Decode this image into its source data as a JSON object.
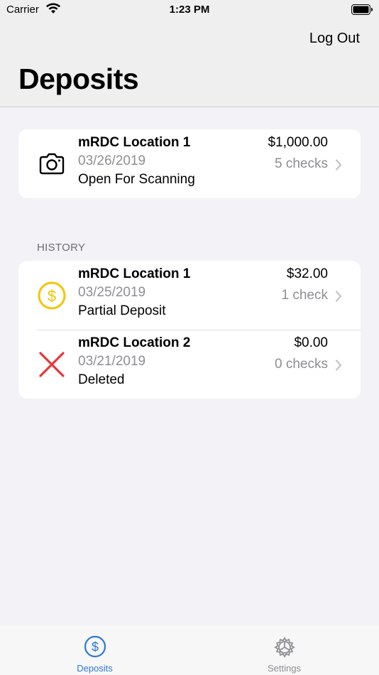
{
  "status_bar": {
    "carrier": "Carrier",
    "time": "1:23 PM"
  },
  "header": {
    "logout_label": "Log Out",
    "title": "Deposits"
  },
  "current_deposit": {
    "name": "mRDC Location 1",
    "date": "03/26/2019",
    "status": "Open For Scanning",
    "amount": "$1,000.00",
    "checks": "5 checks",
    "icon": "camera-icon"
  },
  "history": {
    "section_label": "HISTORY",
    "items": [
      {
        "name": "mRDC Location 1",
        "date": "03/25/2019",
        "status": "Partial Deposit",
        "amount": "$32.00",
        "checks": "1 check",
        "icon": "dollar-circle-icon",
        "icon_color": "#f5c400"
      },
      {
        "name": "mRDC Location 2",
        "date": "03/21/2019",
        "status": "Deleted",
        "amount": "$0.00",
        "checks": "0 checks",
        "icon": "x-mark-icon",
        "icon_color": "#e8363a"
      }
    ]
  },
  "tab_bar": {
    "tabs": [
      {
        "label": "Deposits",
        "icon": "dollar-circle-icon",
        "selected": true,
        "color": "#2f78d6"
      },
      {
        "label": "Settings",
        "icon": "gear-icon",
        "selected": false,
        "color": "#8e8e93"
      }
    ]
  }
}
